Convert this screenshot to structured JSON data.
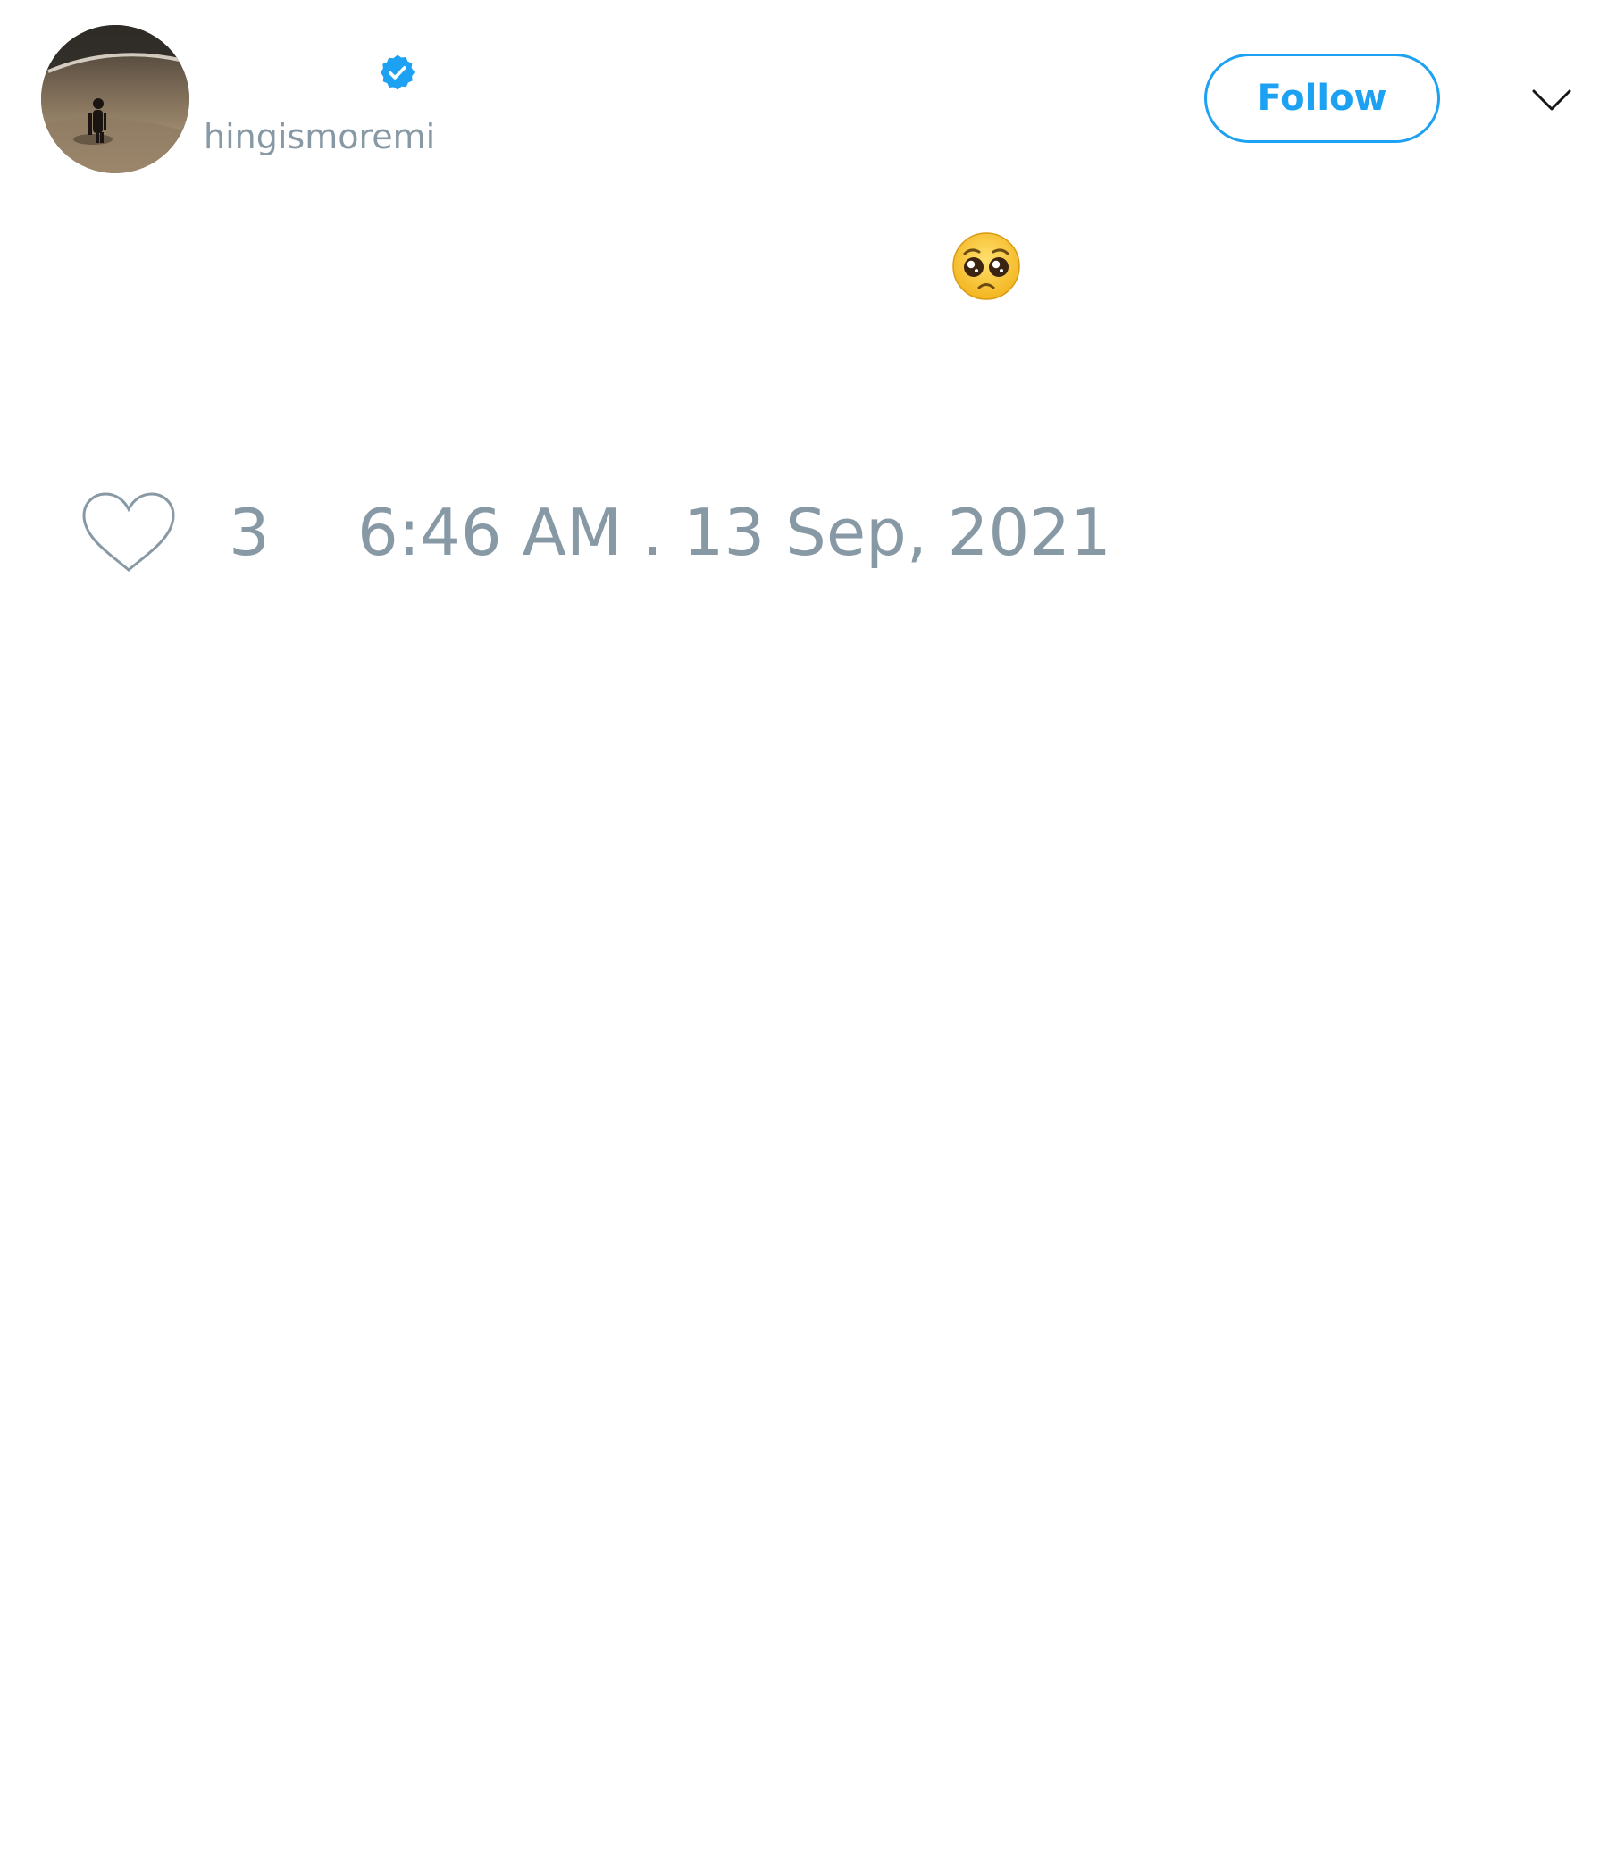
{
  "author": {
    "display_name": "",
    "handle": "hingismoremi",
    "verified": true,
    "avatar_icon": "user-avatar-photo"
  },
  "header": {
    "follow_label": "Follow",
    "menu_icon": "chevron-down-icon"
  },
  "tweet": {
    "text": "",
    "emoji_icon": "pleading-face-emoji"
  },
  "footer": {
    "like_icon": "heart-icon",
    "like_count": "3",
    "timestamp": "6:46 AM . 13 Sep, 2021"
  },
  "colors": {
    "accent": "#1da1f2",
    "muted": "#8899a6",
    "text": "#14171a"
  }
}
